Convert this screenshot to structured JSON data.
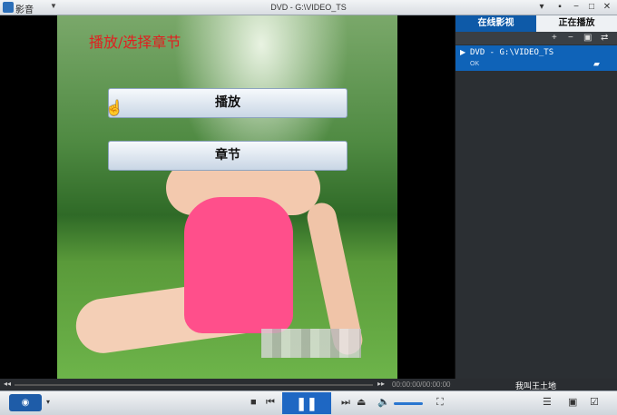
{
  "titlebar": {
    "app_name": "影音",
    "window_title": "DVD - G:\\VIDEO_TS",
    "buttons": [
      "▾",
      "■",
      "−",
      "□",
      "✕"
    ]
  },
  "video": {
    "menu_title": "播放/选择章节",
    "buttons": {
      "play": "播放",
      "chapter": "章节"
    }
  },
  "sidepanel": {
    "tabs": {
      "online": "在线影视",
      "playing": "正在播放"
    },
    "toolbar": [
      "+",
      "−",
      "🗑",
      "⇄"
    ],
    "playlist": [
      {
        "title": "DVD - G:\\VIDEO_TS",
        "status": "OK"
      }
    ]
  },
  "seekbar": {
    "time": "00:00:00/00:00:00",
    "now_playing": "我叫王土地"
  },
  "controls": {
    "play_pause": "❚❚",
    "volume_fraction": 0.85
  }
}
